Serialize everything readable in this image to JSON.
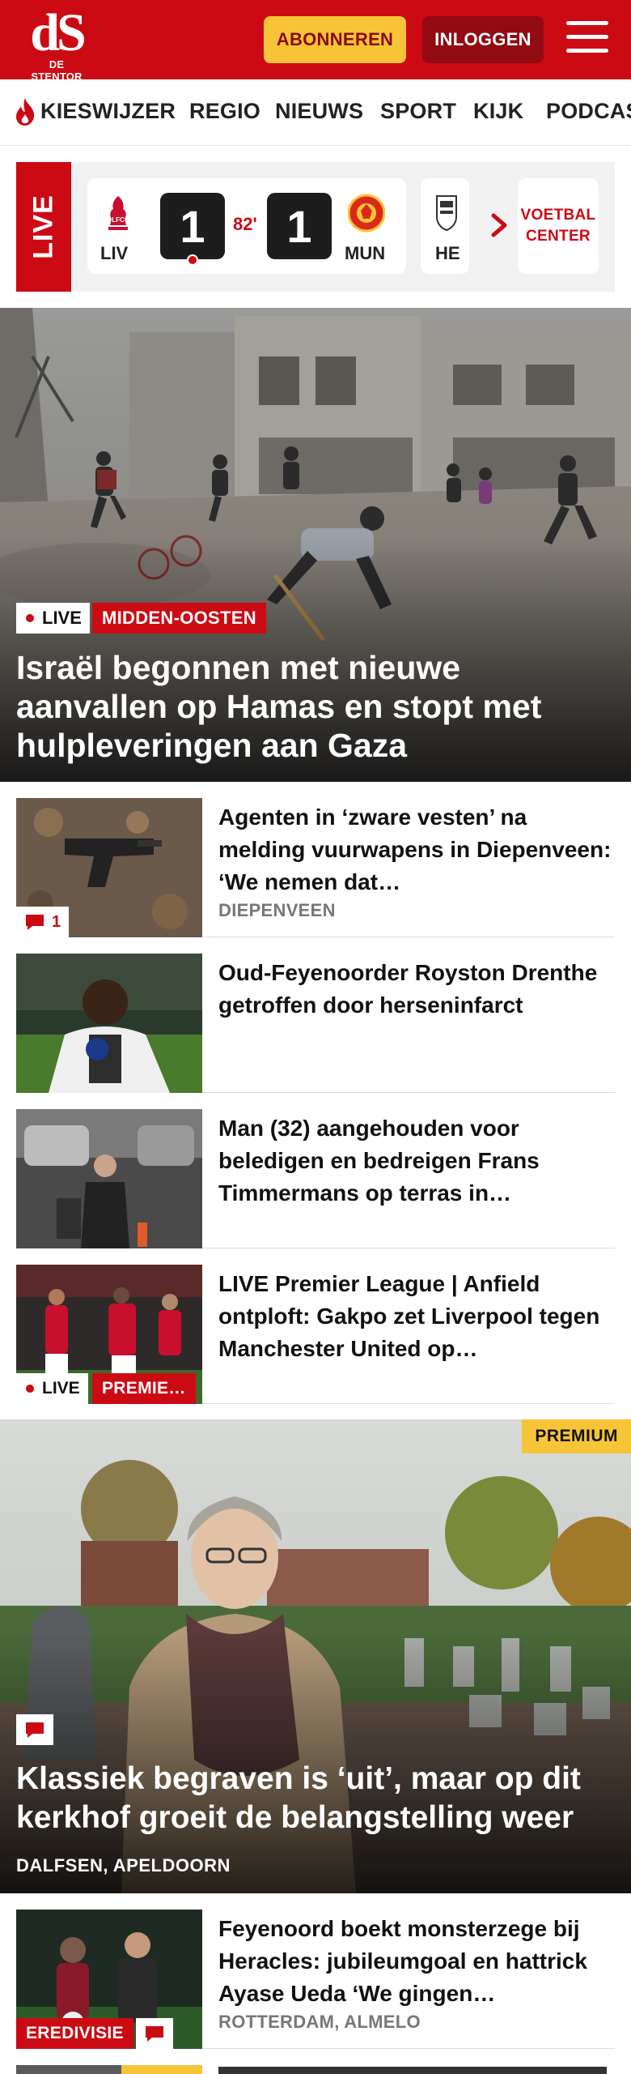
{
  "header": {
    "logo_mark": "dS",
    "logo_name": "DE STENTOR",
    "subscribe_label": "ABONNEREN",
    "login_label": "INLOGGEN",
    "brand_color": "#cc0a14",
    "accent_color": "#f6c537"
  },
  "nav": {
    "items": [
      "KIESWIJZER",
      "REGIO",
      "NIEUWS",
      "SPORT",
      "KIJK",
      "PODCAST"
    ]
  },
  "live": {
    "label": "LIVE",
    "match": {
      "home_code": "LIV",
      "away_code": "MUN",
      "home_score": "1",
      "away_score": "1",
      "minute": "82'"
    },
    "next_team_code": "HE",
    "voetbal_center_label": "VOETBAL CENTER"
  },
  "hero": {
    "live_tag": "LIVE",
    "category": "MIDDEN-OOSTEN",
    "title": "Israël begonnen met nieuwe aanvallen op Hamas en stopt met hulpleveringen aan Gaza"
  },
  "articles": [
    {
      "title": "Agenten in ‘zware vesten’ na melding vuurwapens in Diepenveen: ‘We nemen dat…",
      "location": "DIEPENVEEN",
      "comment_count": "1"
    },
    {
      "title": "Oud-Feyenoorder Royston Drenthe getroffen door hersenin­farct",
      "location": ""
    },
    {
      "title": "Man (32) aangehouden voor beledigen en bedreigen Frans Timmermans op terras in…",
      "location": ""
    },
    {
      "title": "LIVE Premier League | Anfield ontploft: Gakpo zet Liverpool tegen Manchester United op…",
      "location": "",
      "live_tag": "LIVE",
      "category": "PREMIE…"
    }
  ],
  "feature": {
    "badge": "PREMIUM",
    "title": "Klassiek begraven is ‘uit’, maar op dit kerkhof groeit de belangstelling weer",
    "location": "DALFSEN, APELDOORN"
  },
  "article_after": {
    "title": "Feyenoord boekt monsterzege bij Heracles: jubileumgoal en hattrick Ayase Ueda ‘We gingen…",
    "location": "ROTTERDAM, ALMELO",
    "category": "EREDIVISIE"
  },
  "icons": [
    "flame-icon",
    "menu-icon",
    "chevron-right-icon",
    "comment-icon",
    "liverpool-crest-icon",
    "manutd-crest-icon",
    "heracles-crest-icon"
  ]
}
